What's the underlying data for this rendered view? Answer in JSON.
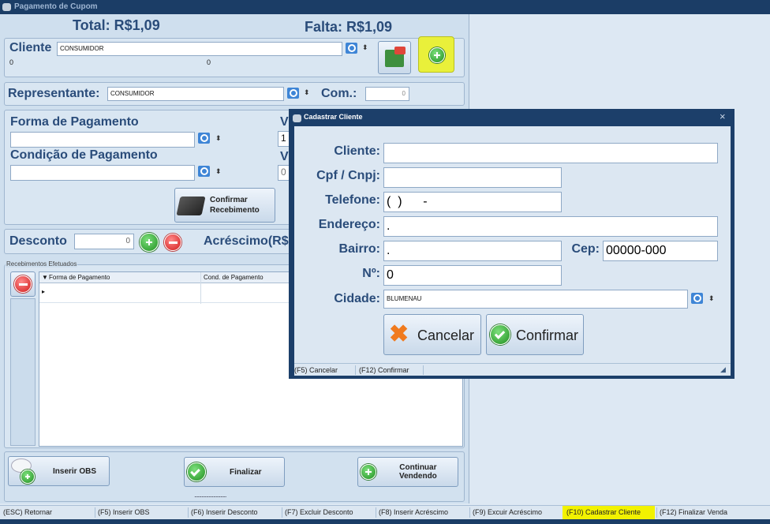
{
  "window": {
    "title": "Pagamento de Cupom"
  },
  "totals": {
    "total_label": "Total: R$1,09",
    "falta_label": "Falta: R$1,09"
  },
  "cliente": {
    "label": "Cliente",
    "value": "CONSUMIDOR",
    "sub_left": "0",
    "sub_right": "0"
  },
  "representante": {
    "label": "Representante:",
    "value": "CONSUMIDOR",
    "com_label": "Com.:",
    "com_value": "0"
  },
  "pagamento": {
    "forma_label": "Forma de Pagamento",
    "condicao_label": "Condição de Pagamento",
    "v1_label": "V",
    "v1_value": "1",
    "v2_label": "V",
    "v2_value": "0",
    "confirmar_line1": "Confirmar",
    "confirmar_line2": "Recebimento"
  },
  "desconto": {
    "label": "Desconto",
    "value": "0",
    "acrescimo_label": "Acréscimo(R$"
  },
  "recebimentos": {
    "title": "Recebimentos Efetuados",
    "columns": [
      "Forma de Pagamento",
      "Cond. de Pagamento"
    ]
  },
  "footer_buttons": {
    "inserir_obs": "Inserir OBS",
    "finalizar": "Finalizar",
    "continuar_1": "Continuar",
    "continuar_2": "Vendendo",
    "dots": "..........................."
  },
  "status_bar": [
    "(ESC) Retornar",
    "(F5) Inserir OBS",
    "(F6) Inserir Desconto",
    "(F7) Excluir Desconto",
    "(F8) Inserir Acréscimo",
    "(F9) Excuir Acréscimo",
    "(F10) Cadastrar Cliente",
    "(F12) Finalizar Venda"
  ],
  "dialog": {
    "title": "Cadastrar Cliente",
    "close": "×",
    "fields": {
      "cliente_label": "Cliente:",
      "cliente_value": "",
      "cpf_label": "Cpf / Cnpj:",
      "cpf_value": "",
      "telefone_label": "Telefone:",
      "telefone_value": "(  )      -",
      "endereco_label": "Endereço:",
      "endereco_value": ".",
      "bairro_label": "Bairro:",
      "bairro_value": ".",
      "cep_label": "Cep:",
      "cep_value": "00000-000",
      "numero_label": "Nº:",
      "numero_value": "0",
      "cidade_label": "Cidade:",
      "cidade_value": "BLUMENAU"
    },
    "cancelar": "Cancelar",
    "confirmar": "Confirmar",
    "status": [
      "(F5) Cancelar",
      "(F12) Confirmar"
    ]
  },
  "colors": {
    "title_bg": "#1b3d66",
    "label_blue": "#2a4c7a",
    "highlight": "#f2f200"
  }
}
